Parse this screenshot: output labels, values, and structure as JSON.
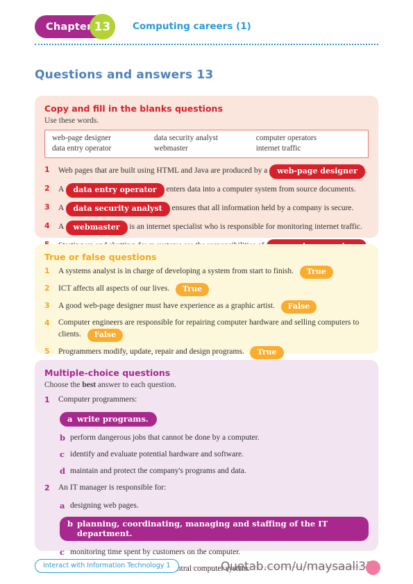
{
  "header": {
    "chapter_label": "Chapter",
    "chapter_number": "13",
    "chapter_title": "Computing careers (1)"
  },
  "page_title": "Questions and answers 13",
  "sections": {
    "fill_blanks": {
      "heading": "Copy and fill in the blanks questions",
      "instruction": "Use these words.",
      "wordbank": [
        [
          "web-page designer",
          "data entry operator"
        ],
        [
          "data security analyst",
          "webmaster"
        ],
        [
          "computer operators",
          "internet traffic"
        ]
      ],
      "questions": [
        {
          "num": "1",
          "before": "Web pages that are built using HTML and Java are produced by a ",
          "answer": "web-page designer",
          "after": "."
        },
        {
          "num": "2",
          "before": "A ",
          "answer": "data entry operator",
          "after": " enters data into a computer system from source documents."
        },
        {
          "num": "3",
          "before": "A ",
          "answer": "data security analyst",
          "after": " ensures that all information held by a company is secure."
        },
        {
          "num": "4",
          "before": "A ",
          "answer": "webmaster",
          "after": " is an internet specialist who is responsible for monitoring internet traffic."
        },
        {
          "num": "5",
          "before": "Starting up and shutting down systems are the responsibilities of ",
          "answer": "computer operators",
          "after": "."
        }
      ]
    },
    "true_false": {
      "heading": "True or false questions",
      "questions": [
        {
          "num": "1",
          "text": "A systems analyst is in charge of developing a system from start to finish.",
          "answer": "True"
        },
        {
          "num": "2",
          "text": "ICT affects all aspects of our lives.",
          "answer": "True"
        },
        {
          "num": "3",
          "text": "A good web-page designer must have experience as a graphic artist.",
          "answer": "False"
        },
        {
          "num": "4",
          "text": "Computer engineers are responsible for repairing computer hardware and selling computers to clients.",
          "answer": "False"
        },
        {
          "num": "5",
          "text": "Programmers modify, update, repair and design programs.",
          "answer": "True"
        }
      ]
    },
    "multiple_choice": {
      "heading": "Multiple-choice questions",
      "instruction_before": "Choose the ",
      "instruction_bold": "best",
      "instruction_after": " answer to each question.",
      "questions": [
        {
          "num": "1",
          "stem": "Computer programmers:",
          "options": [
            {
              "letter": "a",
              "text": "write programs.",
              "correct": true
            },
            {
              "letter": "b",
              "text": "perform dangerous jobs that cannot be done by a computer.",
              "correct": false
            },
            {
              "letter": "c",
              "text": "identify and evaluate potential hardware and software.",
              "correct": false
            },
            {
              "letter": "d",
              "text": "maintain and protect the company's programs and data.",
              "correct": false
            }
          ]
        },
        {
          "num": "2",
          "stem": "An IT manager is responsible for:",
          "options": [
            {
              "letter": "a",
              "text": "designing web pages.",
              "correct": false
            },
            {
              "letter": "b",
              "text": "planning, coordinating, managing and staffing of the IT department.",
              "correct": true
            },
            {
              "letter": "c",
              "text": "monitoring time spent by customers on the computer.",
              "correct": false
            },
            {
              "letter": "d",
              "text": "monitoring and controlling the central computer system.",
              "correct": false
            }
          ]
        }
      ]
    }
  },
  "footer": {
    "book_title": "Interact with Information Technology 1",
    "watermark": "Quetab.com/u/maysaali33"
  },
  "colors": {
    "magenta": "#a8288e",
    "lime": "#b2d236",
    "blue": "#2a9ad6",
    "title_blue": "#4e82bd",
    "red": "#d8202a",
    "orange": "#f9ac2e",
    "pink_panel": "#fae6dd",
    "yellow_panel": "#fdf8dc",
    "purple_panel": "#f2e4f1"
  }
}
